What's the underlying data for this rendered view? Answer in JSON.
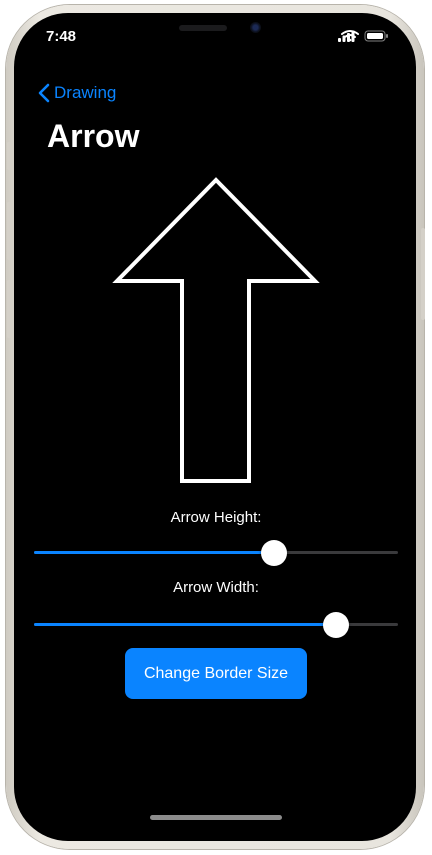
{
  "status": {
    "time": "7:48"
  },
  "nav": {
    "back_label": "Drawing"
  },
  "page": {
    "title": "Arrow"
  },
  "sliders": {
    "height": {
      "label": "Arrow Height:",
      "value": 0.66
    },
    "width": {
      "label": "Arrow Width:",
      "value": 0.83
    }
  },
  "button": {
    "label": "Change Border Size"
  },
  "colors": {
    "accent": "#0a84ff",
    "background": "#000000",
    "track": "#3a3a3c",
    "arrow_stroke": "#ffffff"
  }
}
